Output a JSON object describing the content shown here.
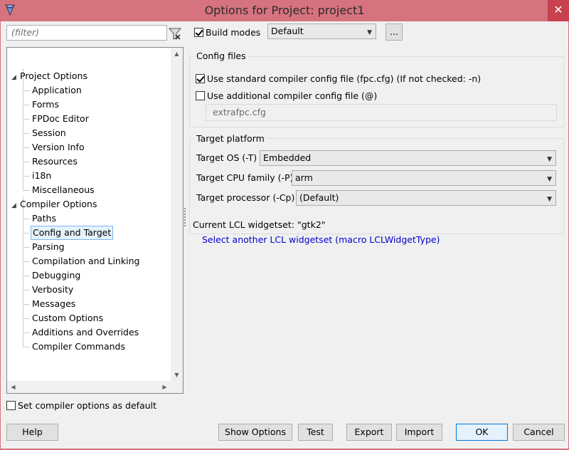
{
  "window": {
    "title": "Options for Project: project1",
    "close_glyph": "✕"
  },
  "filter": {
    "placeholder": "(filter)"
  },
  "tree": {
    "groups": [
      {
        "label": "Project Options",
        "items": [
          "Application",
          "Forms",
          "FPDoc Editor",
          "Session",
          "Version Info",
          "Resources",
          "i18n",
          "Miscellaneous"
        ]
      },
      {
        "label": "Compiler Options",
        "items": [
          "Paths",
          "Config and Target",
          "Parsing",
          "Compilation and Linking",
          "Debugging",
          "Verbosity",
          "Messages",
          "Custom Options",
          "Additions and Overrides",
          "Compiler Commands"
        ]
      }
    ],
    "selected": "Config and Target"
  },
  "build_modes": {
    "checkbox_label": "Build modes",
    "checked": true,
    "combo_value": "Default",
    "ellipsis_label": "..."
  },
  "config_files": {
    "group_title": "Config files",
    "use_standard_label": "Use standard compiler config file (fpc.cfg) (If not checked: -n)",
    "use_standard_checked": true,
    "use_additional_label": "Use additional compiler config file (@)",
    "use_additional_checked": false,
    "additional_value": "extrafpc.cfg"
  },
  "target_platform": {
    "group_title": "Target platform",
    "os_label": "Target OS (-T)",
    "os_value": "Embedded",
    "cpu_label": "Target CPU family (-P)",
    "cpu_value": "arm",
    "processor_label": "Target processor (-Cp)",
    "processor_value": "(Default)"
  },
  "lcl": {
    "current_label": "Current LCL widgetset: \"gtk2\"",
    "select_link": "Select another LCL widgetset (macro LCLWidgetType)"
  },
  "set_default": {
    "label": "Set compiler options as default",
    "checked": false
  },
  "buttons": {
    "help": "Help",
    "show_options": "Show Options",
    "test": "Test",
    "export": "Export",
    "import": "Import",
    "ok": "OK",
    "cancel": "Cancel"
  },
  "colors": {
    "frame": "#d5737f",
    "close": "#c7414f",
    "selection_border": "#7eb4ea",
    "link": "#0000cc"
  }
}
